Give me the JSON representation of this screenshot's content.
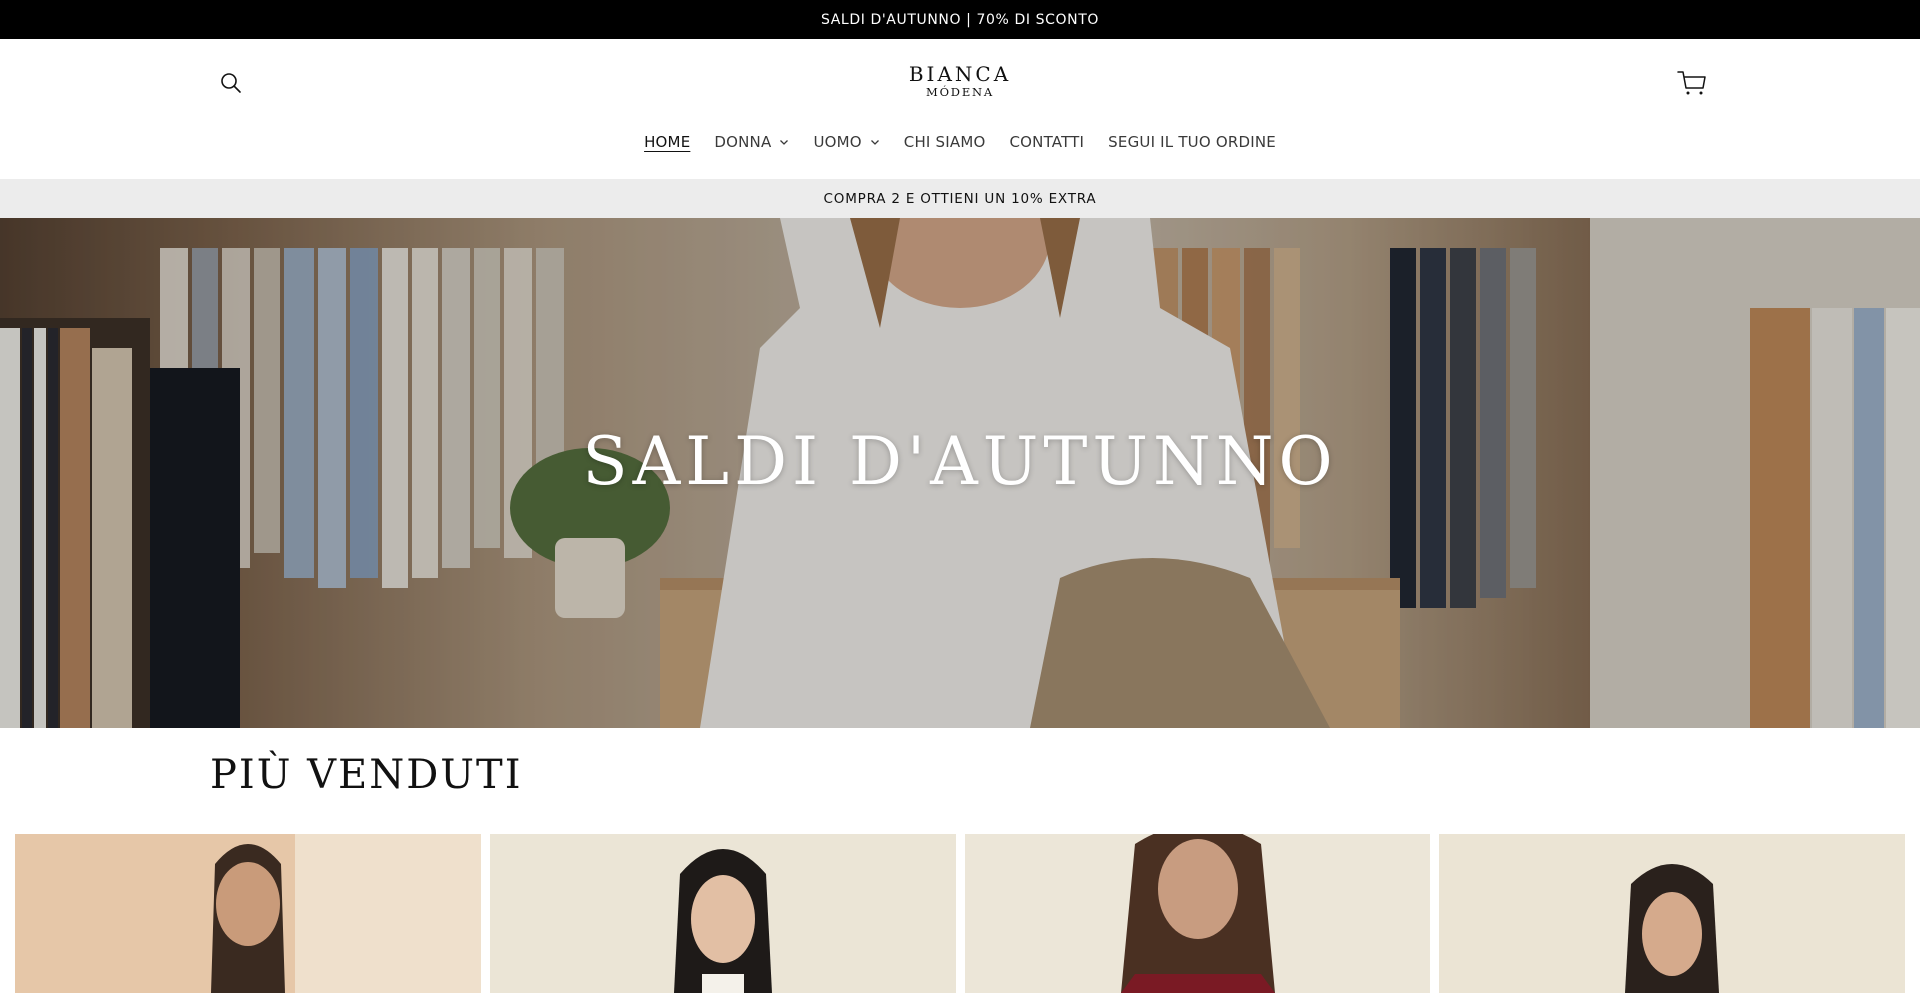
{
  "announcement": {
    "text": "SALDI D'AUTUNNO | 70% DI SCONTO"
  },
  "header": {
    "logo": {
      "brand": "BIANCA",
      "city": "MÓDENA"
    },
    "icons": {
      "search": "search-icon",
      "cart": "cart-icon"
    }
  },
  "nav": {
    "items": [
      {
        "label": "HOME",
        "active": true,
        "dropdown": false
      },
      {
        "label": "DONNA",
        "active": false,
        "dropdown": true
      },
      {
        "label": "UOMO",
        "active": false,
        "dropdown": true
      },
      {
        "label": "CHI SIAMO",
        "active": false,
        "dropdown": false
      },
      {
        "label": "CONTATTI",
        "active": false,
        "dropdown": false
      },
      {
        "label": "SEGUI IL TUO ORDINE",
        "active": false,
        "dropdown": false
      }
    ]
  },
  "promo": {
    "text": "COMPRA 2 E OTTIENI UN 10% EXTRA"
  },
  "hero": {
    "title": "SALDI D'AUTUNNO"
  },
  "best_sellers": {
    "title": "PIÙ VENDUTI",
    "products": [
      {
        "image": "product-photo"
      },
      {
        "image": "product-photo"
      },
      {
        "image": "product-photo"
      },
      {
        "image": "product-photo"
      }
    ]
  },
  "colors": {
    "announcement_bg": "#000000",
    "promo_bg": "#ececec",
    "text": "#121212"
  }
}
